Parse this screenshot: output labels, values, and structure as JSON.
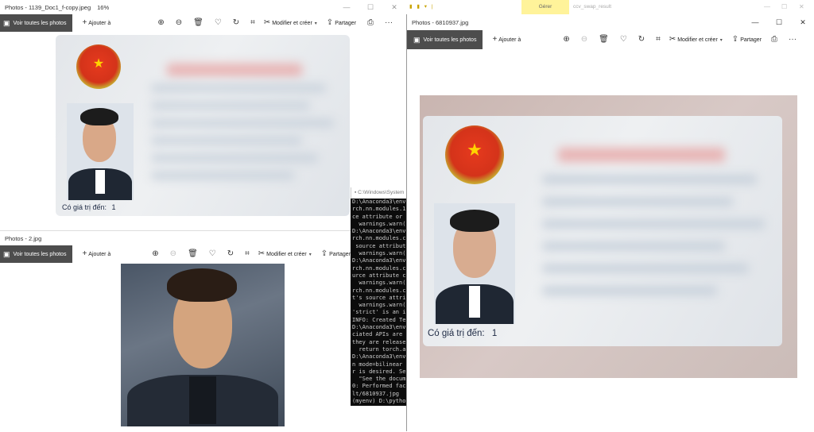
{
  "toolbar": {
    "view_all": "Voir toutes les photos",
    "add_to": "Ajouter à",
    "edit_create": "Modifier et créer",
    "share": "Partager"
  },
  "window_top_left": {
    "title": "Photos - 1139_Doc1_f-copy.jpeg",
    "zoom": "16%",
    "card_validity_label": "Có giá trị đến:",
    "card_validity_value": "1"
  },
  "window_bottom_left": {
    "title": "Photos - 2.jpg"
  },
  "window_right": {
    "title": "Photos - 6810937.jpg",
    "card_validity_label": "Có giá trị đến:",
    "card_validity_value": "1"
  },
  "explorer_strip": {
    "manage_tab": "Gérer",
    "path_text": "ccv_swap_result"
  },
  "console": {
    "title": "C:\\Windows\\System",
    "lines": [
      "D:\\Anaconda3\\env",
      "rch.nn.modules.1",
      "ce attribute or",
      "  warnings.warn(",
      "D:\\Anaconda3\\env",
      "rch.nn.modules.c",
      " source attribut",
      "  warnings.warn(",
      "D:\\Anaconda3\\env",
      "rch.nn.modules.c",
      "urce attribute c",
      "  warnings.warn(",
      "rch.nn.modules.c",
      "t's source attri",
      "  warnings.warn(",
      "'strict' is an i",
      "INFO: Created Te",
      "D:\\Anaconda3\\env",
      "ciated APIs are",
      "they are release",
      "  return torch.a",
      "D:\\Anaconda3\\env",
      "n mode=bilinear",
      "r is desired. Se",
      "  \"See the docum",
      "0: Performed fac",
      "lt/6810937.jpg",
      "",
      "(myenv) D:\\pytho"
    ]
  }
}
